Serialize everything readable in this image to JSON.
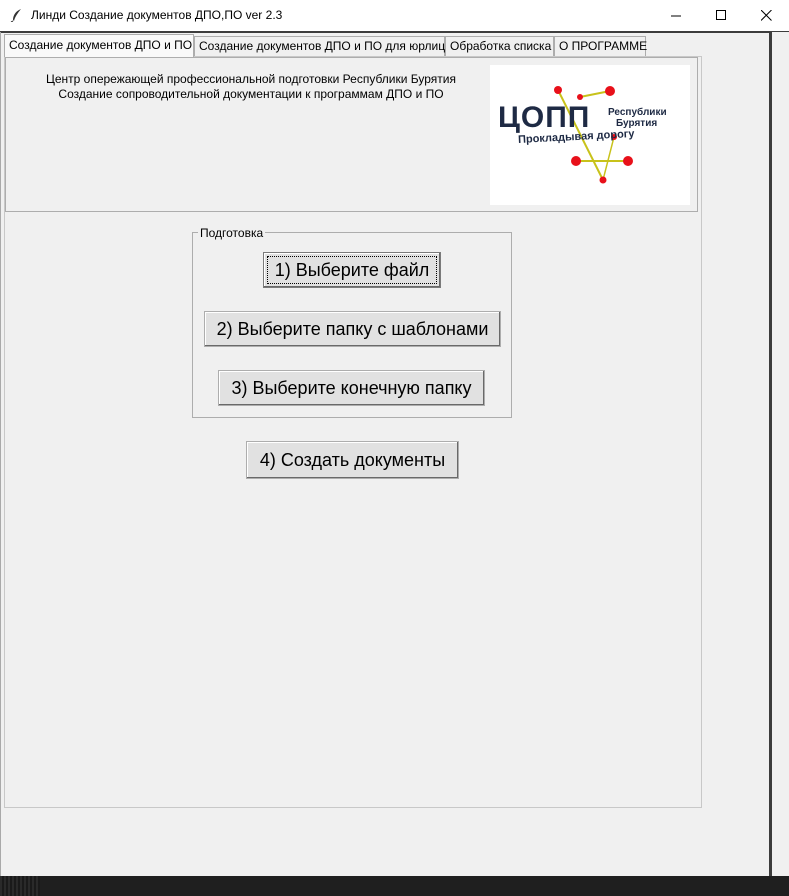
{
  "window": {
    "title": "Линди Создание документов ДПО,ПО ver 2.3",
    "icon": "feather-icon"
  },
  "tabs": [
    {
      "label": "Создание документов ДПО и ПО",
      "active": true
    },
    {
      "label": "Создание документов ДПО и ПО для юрлиц",
      "active": false
    },
    {
      "label": "Обработка списка",
      "active": false
    },
    {
      "label": "О ПРОГРАММЕ",
      "active": false
    }
  ],
  "header": {
    "line1": "Центр опережающей профессиональной подготовки Республики Бурятия",
    "line2": "Создание сопроводительной документации к программам ДПО и ПО"
  },
  "logo": {
    "main": "ЦОПП",
    "sub1": "Республики",
    "sub2": "Бурятия",
    "tagline": "Прокладывая дорогу",
    "dot_color": "#e8101a",
    "line_color": "#c8c21a",
    "text_color": "#1e2a44"
  },
  "prep_group": {
    "label": "Подготовка",
    "select_file": "1) Выберите файл",
    "select_templates": "2) Выберите папку с шаблонами",
    "select_output": "3) Выберите конечную папку"
  },
  "create_button": "4) Создать документы"
}
